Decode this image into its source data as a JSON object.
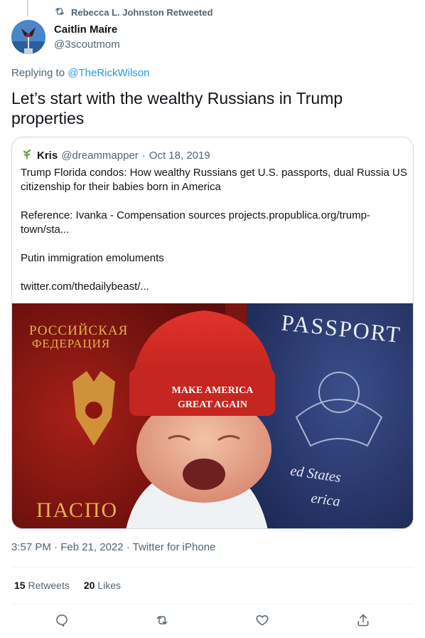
{
  "retweet": {
    "text": "Rebecca L. Johnston Retweeted"
  },
  "author": {
    "name": "Caitlin Maíre",
    "handle": "@3scoutmom"
  },
  "reply": {
    "prefix": "Replying to ",
    "target": "@TheRickWilson"
  },
  "tweet": {
    "text": "Let’s start with the wealthy Russians in Trump properties"
  },
  "quote": {
    "name": "Kris",
    "handle": "@dreammapper",
    "separator": "·",
    "date": "Oct 18, 2019",
    "paragraphs": [
      "Trump Florida condos: How wealthy Russians get U.S. passports, dual Russia US citizenship for their babies born in America",
      "Reference: Ivanka - Compensation sources projects.propublica.org/trump-town/sta...",
      "Putin immigration emoluments",
      "twitter.com/thedailybeast/..."
    ],
    "image": {
      "russian_line1": "РОССИЙСКАЯ",
      "russian_line2": "ФЕДЕРАЦИЯ",
      "russian_bottom": "ПАСПО",
      "passport_word": "PASSPORT",
      "us_line1": "ed States",
      "us_line2": "erica",
      "hat_line1": "MAKE AMERICA",
      "hat_line2": "GREAT AGAIN"
    }
  },
  "meta": {
    "text": "3:57 PM · Feb 21, 2022 · Twitter for iPhone"
  },
  "stats": {
    "retweets_count": "15",
    "retweets_label": "Retweets",
    "likes_count": "20",
    "likes_label": "Likes"
  },
  "colors": {
    "accent": "#1d9bf0",
    "muted": "#536471",
    "text": "#0f1419",
    "border": "#cfd9de"
  },
  "icons": [
    "retweet-icon",
    "plant-icon",
    "reply-icon",
    "like-icon",
    "share-icon"
  ]
}
